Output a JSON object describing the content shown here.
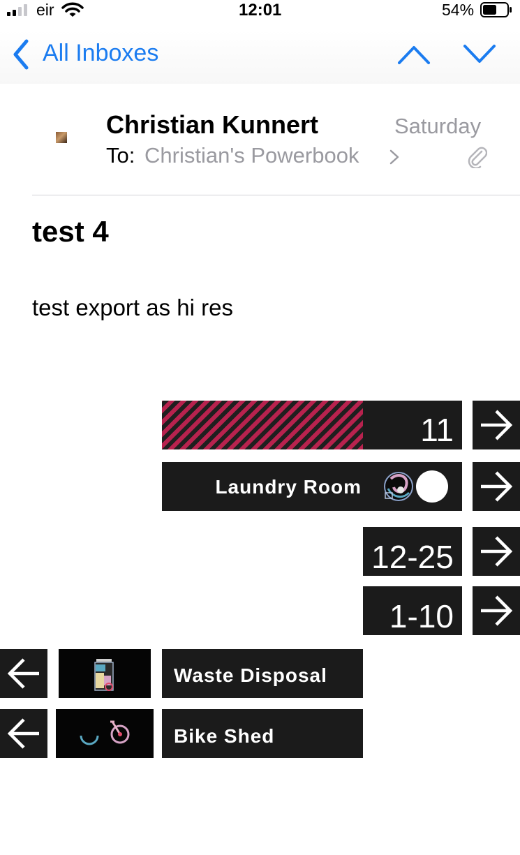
{
  "status_bar": {
    "carrier": "eir",
    "time": "12:01",
    "battery_percent": "54%",
    "battery_level": 0.54,
    "signal_bars": 2
  },
  "nav": {
    "back_label": "All Inboxes",
    "accent_color": "#1b7cf0"
  },
  "message": {
    "sender": "Christian Kunnert",
    "date": "Saturday",
    "to_label": "To:",
    "to_value": "Christian's Powerbook",
    "subject": "test 4",
    "body": "test export as hi res"
  },
  "signage": {
    "room_number": "11",
    "laundry_label": "Laundry Room",
    "range_1": "12-25",
    "range_2": "1-10",
    "waste_label": "Waste Disposal",
    "bike_label": "Bike Shed",
    "hatch_color": "#b8224e",
    "panel_color": "#1b1b1b"
  }
}
